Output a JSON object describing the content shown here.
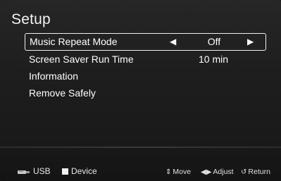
{
  "screen": {
    "title": "Setup"
  },
  "menu": {
    "items": [
      {
        "label": "Music Repeat Mode",
        "value": "Off",
        "selected": true
      },
      {
        "label": "Screen Saver Run Time",
        "value": "10 min",
        "selected": false
      },
      {
        "label": "Information",
        "value": "",
        "selected": false
      },
      {
        "label": "Remove Safely",
        "value": "",
        "selected": false
      }
    ],
    "left_arrow": "◀",
    "right_arrow": "▶"
  },
  "footer": {
    "source_usb": "USB",
    "source_device": "Device",
    "hint_move": "Move",
    "hint_adjust": "Adjust",
    "hint_return": "Return",
    "glyph_move": "⇕",
    "glyph_adjust": "◀▶",
    "glyph_return": "↺"
  },
  "colors": {
    "background": "#1a1a1a",
    "text": "#ffffff",
    "selection_border": "#f0f0f0"
  },
  "icons": {
    "usb": "usb-icon",
    "device": "device-icon"
  }
}
